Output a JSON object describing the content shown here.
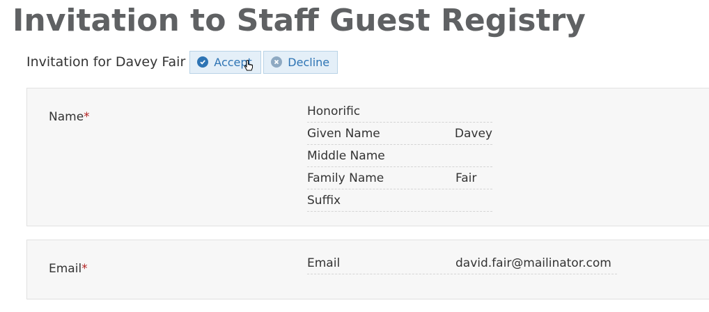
{
  "page": {
    "title": "Invitation to Staff Guest Registry"
  },
  "invitation": {
    "text": "Invitation for Davey Fair",
    "accept_label": "Accept",
    "decline_label": "Decline"
  },
  "form": {
    "name_field": {
      "label": "Name",
      "required_mark": "*",
      "rows": [
        {
          "key": "Honorific",
          "value": ""
        },
        {
          "key": "Given Name",
          "value": "Davey"
        },
        {
          "key": "Middle Name",
          "value": ""
        },
        {
          "key": "Family Name",
          "value": "Fair"
        },
        {
          "key": "Suffix",
          "value": ""
        }
      ]
    },
    "email_field": {
      "label": "Email",
      "required_mark": "*",
      "rows": [
        {
          "key": "Email",
          "value": "david.fair@mailinator.com"
        }
      ]
    }
  },
  "colors": {
    "accent": "#2e74b4",
    "title": "#5f6163",
    "required": "#b22222"
  }
}
